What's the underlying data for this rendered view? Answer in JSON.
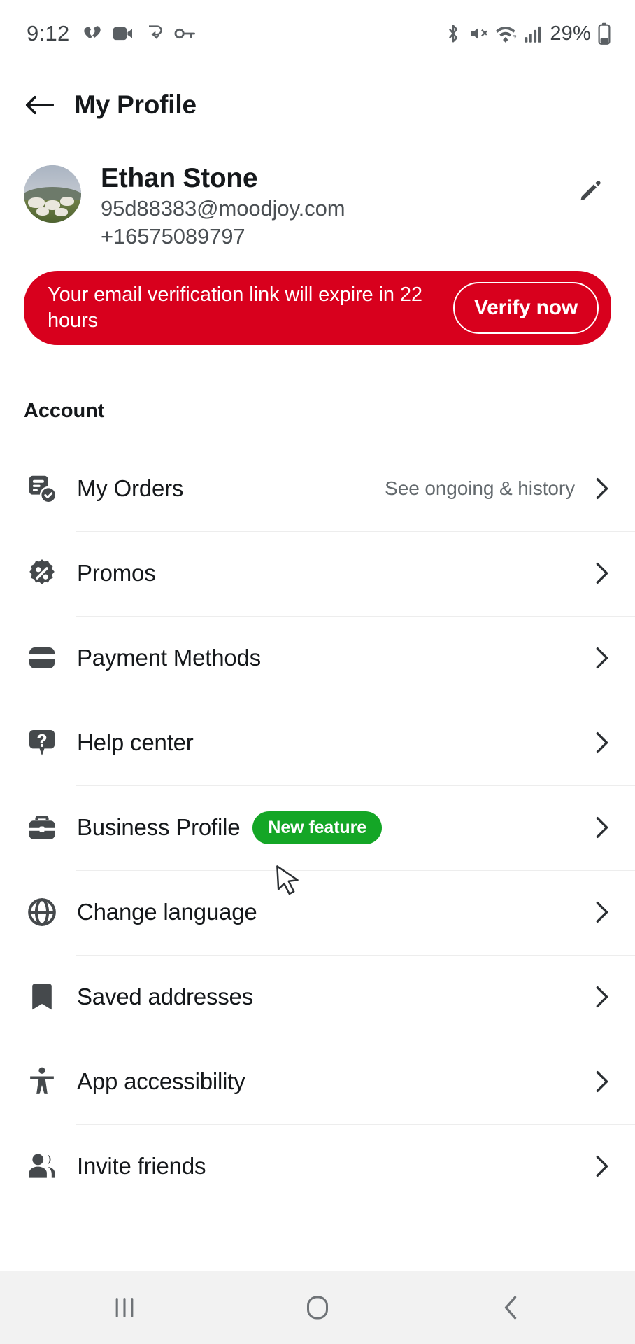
{
  "status_bar": {
    "time": "9:12",
    "battery_percent": "29%",
    "left_icons": [
      "heart-rate-icon",
      "video-camera-icon",
      "data-sync-icon",
      "vpn-key-icon"
    ],
    "right_icons": [
      "bluetooth-icon",
      "mute-icon",
      "wifi-icon",
      "cellular-signal-icon",
      "battery-icon"
    ]
  },
  "app_bar": {
    "back_icon": "arrow-left-icon",
    "title": "My Profile"
  },
  "profile": {
    "avatar_alt": "sheep-photo-avatar",
    "name": "Ethan Stone",
    "email": "95d88383@moodjoy.com",
    "phone": "+16575089797",
    "edit_icon": "pencil-icon"
  },
  "banner": {
    "message": "Your email verification link will expire in 22 hours",
    "action_label": "Verify now",
    "background_color": "#d8001d",
    "text_color": "#ffffff"
  },
  "account_section": {
    "title": "Account",
    "items": [
      {
        "label": "My Orders",
        "icon": "orders-receipt-icon",
        "value": "See ongoing & history",
        "badge": ""
      },
      {
        "label": "Promos",
        "icon": "discount-badge-icon",
        "value": "",
        "badge": ""
      },
      {
        "label": "Payment Methods",
        "icon": "credit-card-icon",
        "value": "",
        "badge": ""
      },
      {
        "label": "Help center",
        "icon": "question-bubble-icon",
        "value": "",
        "badge": ""
      },
      {
        "label": "Business Profile",
        "icon": "briefcase-icon",
        "value": "",
        "badge": "New feature"
      },
      {
        "label": "Change language",
        "icon": "globe-icon",
        "value": "",
        "badge": ""
      },
      {
        "label": "Saved addresses",
        "icon": "bookmark-icon",
        "value": "",
        "badge": ""
      },
      {
        "label": "App accessibility",
        "icon": "accessibility-icon",
        "value": "",
        "badge": ""
      },
      {
        "label": "Invite friends",
        "icon": "people-group-icon",
        "value": "",
        "badge": ""
      }
    ],
    "chevron_icon": "chevron-right-icon",
    "badge_color": "#14a626"
  },
  "nav_bar": {
    "recents_icon": "recents-icon",
    "home_icon": "home-icon",
    "back_icon": "back-icon"
  },
  "cursor": {
    "icon": "mouse-pointer-icon"
  }
}
